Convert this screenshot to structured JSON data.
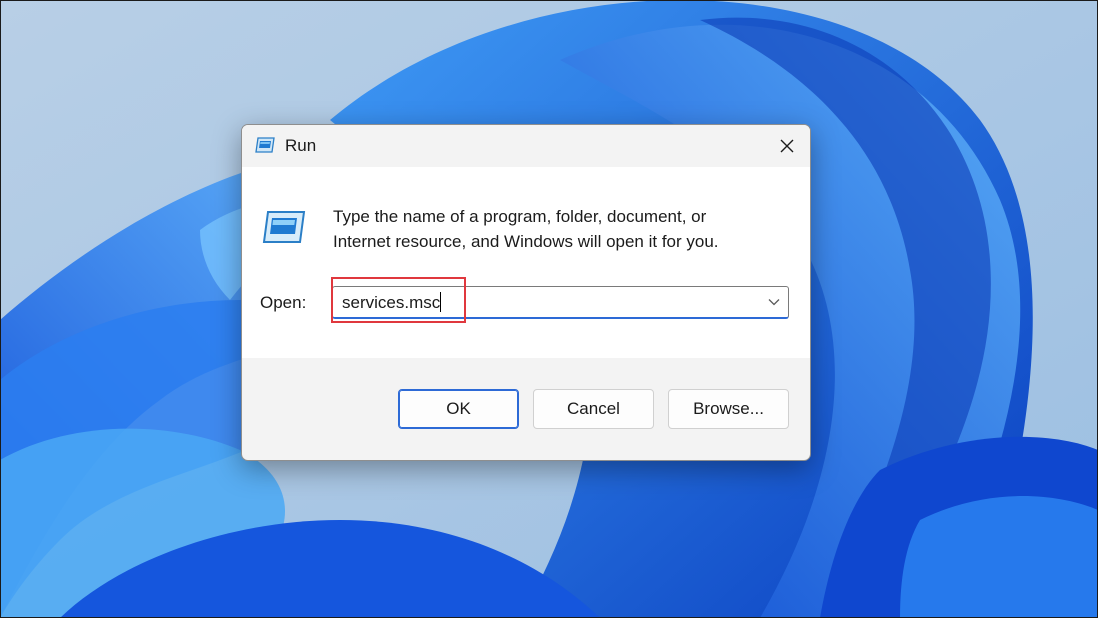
{
  "desktop": {
    "wallpaper": "windows-11-bloom-wallpaper",
    "colors": {
      "sky": "#a9c6e3",
      "bloom_dark": "#0b3fc2",
      "bloom_mid": "#1a66e6",
      "bloom_light": "#4aa8f5"
    }
  },
  "dialog": {
    "title": "Run",
    "title_icon": "run-icon",
    "close_icon": "close-icon",
    "big_icon": "run-icon",
    "description_line1": "Type the name of a program, folder, document, or",
    "description_line2": "Internet resource, and Windows will open it for you.",
    "open_label": "Open:",
    "open_value": "services.msc",
    "dropdown_icon": "chevron-down-icon",
    "buttons": {
      "ok": "OK",
      "cancel": "Cancel",
      "browse": "Browse..."
    }
  },
  "annotation": {
    "highlight_color": "#e0383e"
  }
}
